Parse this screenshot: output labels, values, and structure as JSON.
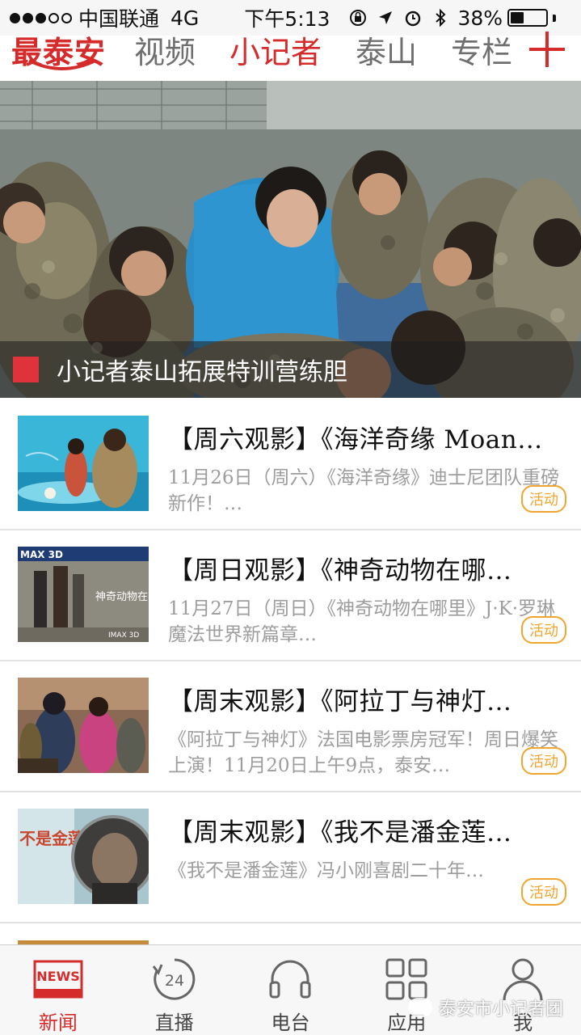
{
  "status_bar": {
    "carrier": "中国联通",
    "network": "4G",
    "time": "下午5:13",
    "battery_percent": "38%",
    "battery_level": 0.38,
    "icons": [
      "lock-rotation-icon",
      "location-arrow-icon",
      "alarm-icon",
      "bluetooth-icon"
    ]
  },
  "top_nav": {
    "logo": "最泰安",
    "tabs": [
      {
        "label": "视频",
        "active": false
      },
      {
        "label": "小记者",
        "active": true
      },
      {
        "label": "泰山",
        "active": false
      },
      {
        "label": "专栏",
        "active": false
      }
    ],
    "accent_color": "#d62b2b"
  },
  "hero": {
    "caption": "小记者泰山拓展特训营练胆"
  },
  "news": [
    {
      "title": "【周六观影】《海洋奇缘 Moan…",
      "summary": "11月26日（周六）《海洋奇缘》迪士尼团队重磅新作！…",
      "tag": "活动",
      "thumb_text": ""
    },
    {
      "title": "【周日观影】《神奇动物在哪…",
      "summary": "11月27日（周日）《神奇动物在哪里》J·K·罗琳 魔法世界新篇章…",
      "tag": "活动",
      "thumb_text": "MAX 3D",
      "thumb_text2": "神奇动物在哪里",
      "thumb_text3": "IMAX 3D"
    },
    {
      "title": "【周末观影】《阿拉丁与神灯…",
      "summary": "《阿拉丁与神灯》法国电影票房冠军！周日爆笑上演！11月20日上午9点，泰安…",
      "tag": "活动",
      "thumb_text": ""
    },
    {
      "title": "【周末观影】《我不是潘金莲…",
      "summary": "《我不是潘金莲》冯小刚喜剧二十年…",
      "tag": "活动",
      "thumb_text": "不是金莲"
    }
  ],
  "tab_bar": {
    "items": [
      {
        "label": "新闻",
        "icon": "news-icon",
        "icon_text": "NEWS",
        "active": true
      },
      {
        "label": "直播",
        "icon": "live-24-icon",
        "icon_text": "24",
        "active": false
      },
      {
        "label": "电台",
        "icon": "headphones-icon",
        "active": false
      },
      {
        "label": "应用",
        "icon": "apps-grid-icon",
        "active": false
      },
      {
        "label": "我",
        "icon": "person-icon",
        "active": false
      }
    ]
  },
  "watermark": "泰安市小记者团"
}
